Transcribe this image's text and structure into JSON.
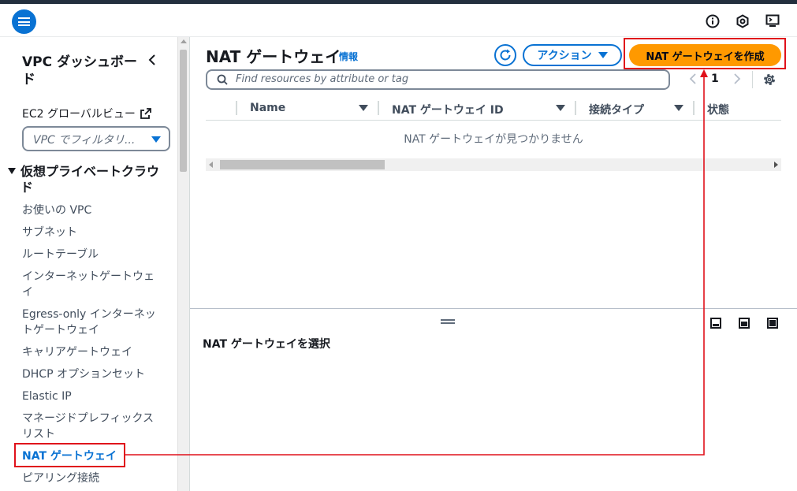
{
  "sidebar": {
    "title": "VPC ダッシュボード",
    "ec2_link": "EC2 グローバルビュー",
    "filter_placeholder": "VPC でフィルタリ...",
    "section_title": "仮想プライベートクラウド",
    "items": [
      {
        "label": "お使いの VPC",
        "active": false
      },
      {
        "label": "サブネット",
        "active": false
      },
      {
        "label": "ルートテーブル",
        "active": false
      },
      {
        "label": "インターネットゲートウェイ",
        "active": false
      },
      {
        "label": "Egress-only インターネットゲートウェイ",
        "active": false
      },
      {
        "label": "キャリアゲートウェイ",
        "active": false
      },
      {
        "label": "DHCP オプションセット",
        "active": false
      },
      {
        "label": "Elastic IP",
        "active": false
      },
      {
        "label": "マネージドプレフィックスリスト",
        "active": false
      },
      {
        "label": "NAT ゲートウェイ",
        "active": true
      },
      {
        "label": "ピアリング接続",
        "active": false
      }
    ]
  },
  "main": {
    "title": "NAT ゲートウェイ",
    "info": "情報",
    "actions_label": "アクション",
    "create_label": "NAT ゲートウェイを作成",
    "search_placeholder": "Find resources by attribute or tag",
    "page_number": "1",
    "columns": [
      "Name",
      "NAT ゲートウェイ ID",
      "接続タイプ",
      "状態"
    ],
    "empty_message": "NAT ゲートウェイが見つかりません"
  },
  "details": {
    "title": "NAT ゲートウェイを選択"
  },
  "colors": {
    "accent": "#0972d3",
    "primary_button": "#ff9900",
    "annotation": "#e0111b"
  }
}
